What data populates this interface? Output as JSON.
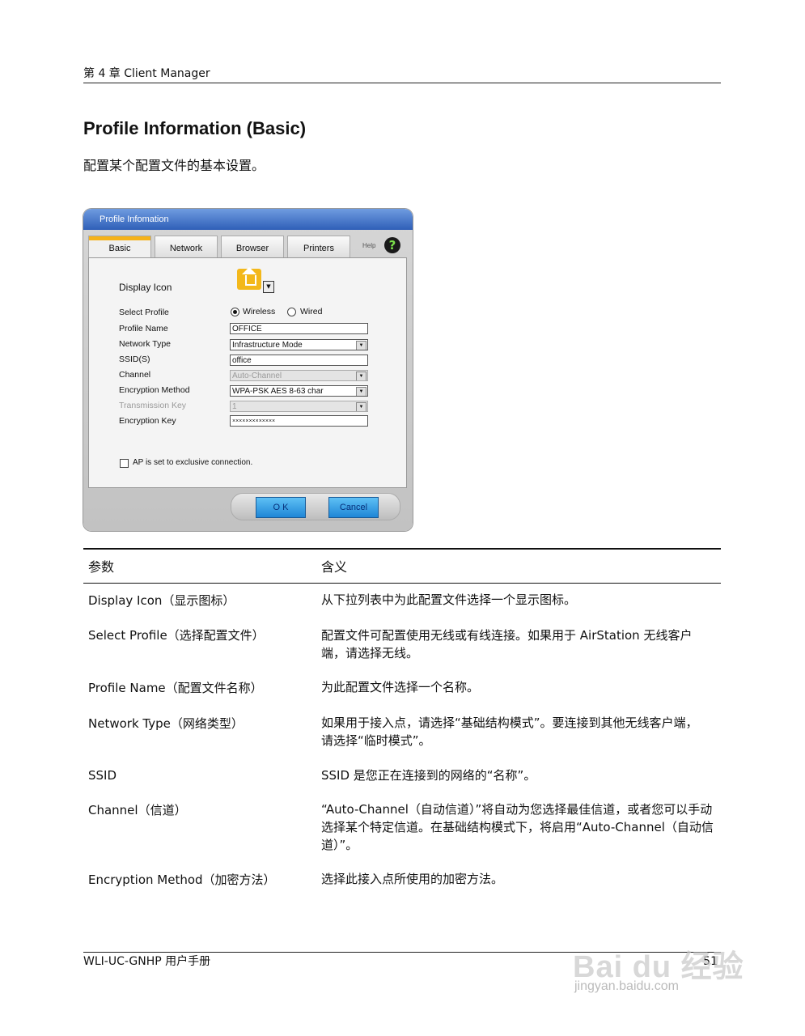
{
  "header": {
    "chapter": "第 4 章 Client Manager"
  },
  "title": "Profile Information (Basic)",
  "subtitle": "配置某个配置文件的基本设置。",
  "dialog": {
    "title": "Profile Infomation",
    "tabs": [
      "Basic",
      "Network",
      "Browser",
      "Printers"
    ],
    "help": "Help",
    "help_icon": "question-icon",
    "display_icon_label": "Display Icon",
    "select_profile_label": "Select Profile",
    "radio_wireless": "Wireless",
    "radio_wired": "Wired",
    "profile_name_label": "Profile Name",
    "profile_name_value": "OFFICE",
    "network_type_label": "Network Type",
    "network_type_value": "Infrastructure Mode",
    "ssid_label": "SSID(S)",
    "ssid_value": "office",
    "channel_label": "Channel",
    "channel_value": "Auto-Channel",
    "encryption_method_label": "Encryption Method",
    "encryption_method_value": "WPA-PSK AES 8-63 char",
    "transmission_key_label": "Transmission Key",
    "transmission_key_value": "1",
    "encryption_key_label": "Encryption Key",
    "encryption_key_value": "×××××××××××××",
    "exclusive_label": "AP is set to exclusive connection.",
    "ok": "O K",
    "cancel": "Cancel"
  },
  "table": {
    "headers": [
      "参数",
      "含义"
    ],
    "rows": [
      {
        "param": "Display Icon（显示图标）",
        "meaning": "从下拉列表中为此配置文件选择一个显示图标。"
      },
      {
        "param": "Select Profile（选择配置文件）",
        "meaning": "配置文件可配置使用无线或有线连接。如果用于 AirStation 无线客户端，请选择无线。"
      },
      {
        "param": "Profile Name（配置文件名称）",
        "meaning": "为此配置文件选择一个名称。"
      },
      {
        "param": "Network Type（网络类型）",
        "meaning": "如果用于接入点，请选择“基础结构模式”。要连接到其他无线客户端，请选择“临时模式”。"
      },
      {
        "param": "SSID",
        "meaning": "SSID 是您正在连接到的网络的“名称”。"
      },
      {
        "param": "Channel（信道）",
        "meaning": "“Auto-Channel（自动信道）”将自动为您选择最佳信道，或者您可以手动选择某个特定信道。在基础结构模式下，将启用“Auto-Channel（自动信道）”。"
      },
      {
        "param": "Encryption Method（加密方法）",
        "meaning": "选择此接入点所使用的加密方法。"
      }
    ]
  },
  "footer": {
    "manual": "WLI-UC-GNHP 用户手册",
    "page": "51"
  },
  "watermark": {
    "main": "Bai du 经验",
    "sub": "jingyan.baidu.com"
  }
}
